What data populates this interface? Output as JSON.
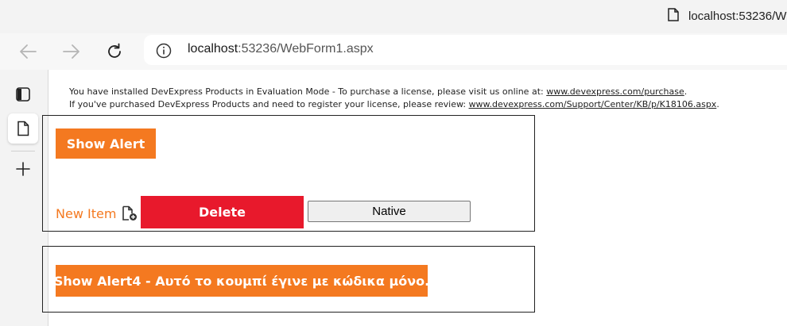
{
  "browser": {
    "tab_title": "localhost:53236/W",
    "url_host": "localhost",
    "url_rest": ":53236/WebForm1.aspx"
  },
  "notice": {
    "line1_text": "You have installed DevExpress Products in Evaluation Mode - To purchase a license, please visit us online at: ",
    "line1_link": "www.devexpress.com/purchase",
    "line1_end": ".",
    "line2_text": "If you've purchased DevExpress Products and need to register your license, please review: ",
    "line2_link": "www.devexpress.com/Support/Center/KB/p/K18106.aspx",
    "line2_end": "."
  },
  "panel1": {
    "show_alert_label": "Show Alert",
    "new_item_label": "New Item",
    "delete_label": "Delete",
    "native_label": "Native"
  },
  "panel2": {
    "show_alert4_label": "Show Alert4 - Αυτό το κουμπί έγινε με κώδικα μόνο."
  },
  "colors": {
    "accent_orange": "#f47920",
    "delete_red": "#e8192c"
  },
  "icons": {
    "tab": "page-icon",
    "back": "arrow-left-icon",
    "forward": "arrow-right-icon",
    "reload": "reload-icon",
    "site_info": "info-icon",
    "sidebar_tabs": "tab-actions-icon",
    "sidebar_page": "page-icon",
    "sidebar_add": "plus-icon",
    "new_item": "add-document-icon"
  }
}
